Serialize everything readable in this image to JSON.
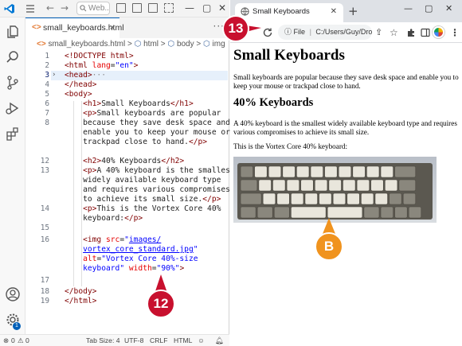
{
  "vscode": {
    "search_placeholder": "Web...",
    "tab_label": "small_keyboards.html",
    "breadcrumb": {
      "file": "small_keyboards.html",
      "sep": ">",
      "c1": "html",
      "c2": "body",
      "c3": "img"
    },
    "line_numbers": [
      "1",
      "2",
      "3",
      "4",
      "5",
      "",
      "",
      "",
      "",
      "12",
      "13",
      "",
      "",
      "14",
      "",
      "15",
      "16",
      "",
      "",
      "17",
      "18",
      "19"
    ],
    "status": {
      "errors": "0",
      "warnings": "0",
      "tab_size": "Tab Size: 4",
      "encoding": "UTF-8",
      "eol": "CRLF",
      "language": "HTML"
    },
    "settings_badge": "1"
  },
  "browser": {
    "tab_title": "Small Keyboards",
    "address_label": "File",
    "address_path": "C:/Users/Guy/Dro...",
    "heading1": "Small Keyboards",
    "para1": "Small keyboards are popular because they save desk space and enable you to keep your mouse or trackpad close to hand.",
    "heading2": "40% Keyboards",
    "para2": "A 40% keyboard is the smallest widely available keyboard type and requires various compromises to achieve its small size.",
    "para3": "This is the Vortex Core 40% keyboard:"
  },
  "callouts": {
    "step13": "13",
    "step12": "12",
    "stepB": "B"
  },
  "colors": {
    "callout_red": "#c8102e",
    "callout_orange": "#f0931e",
    "tag": "#800000",
    "attr": "#e50000",
    "value": "#0000ff"
  }
}
